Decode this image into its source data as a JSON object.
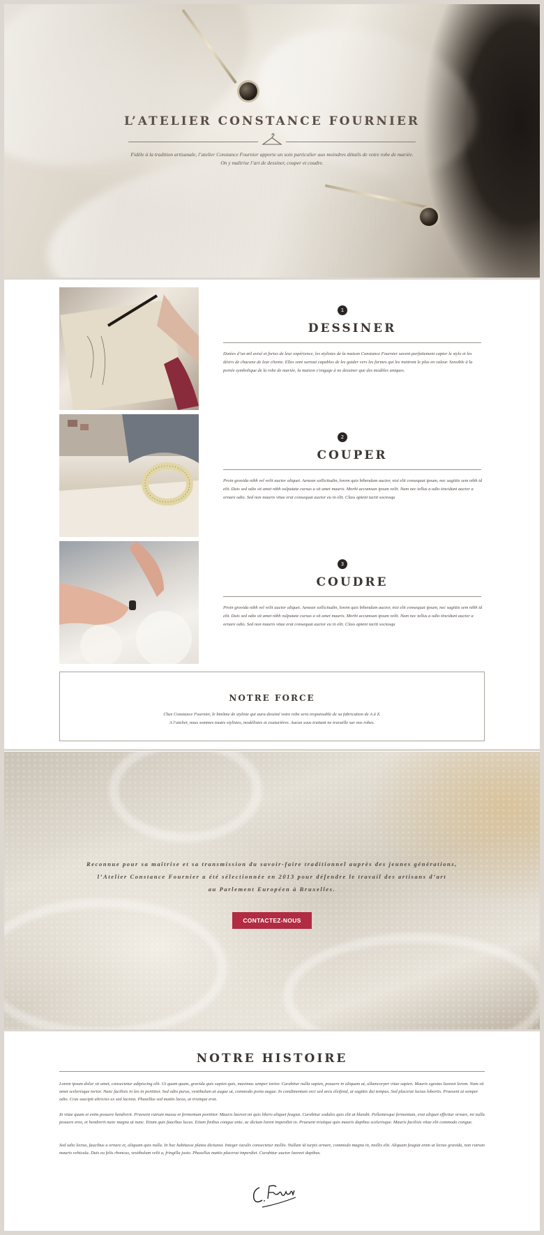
{
  "hero": {
    "title": "L’ATELIER CONSTANCE FOURNIER",
    "tagline_line1": "Fidèle à la tradition artisanale, l’atelier Constance Fournier apporte un soin particulier aux moindres détails de votre robe de mariée.",
    "tagline_line2": "On y maîtrise l’art de dessiner, couper et coudre.",
    "icon": "hanger-icon"
  },
  "steps": [
    {
      "number": "1",
      "title": "DESSINER",
      "text": "Dotées d’un œil avisé et fortes de leur expérience, les stylistes de la maison Constance Fournier savent parfaitement capter le style et les désirs de chacune de leur cliente. Elles sont surtout capables de les guider vers les formes qui les mettront le plus en valeur. Sensible à la portée symbolique de la robe de mariée, la maison s’engage à ne dessiner que des modèles uniques."
    },
    {
      "number": "2",
      "title": "COUPER",
      "text": "Proin gravida nibh vel velit auctor aliquet. Aenean sollicitudin, lorem quis bibendum auctor, nisi elit consequat ipsum, nec sagittis sem nibh id elit. Duis sed odio sit amet nibh vulputate cursus a sit amet mauris. Morbi accumsan ipsum velit. Nam nec tellus a odio tincidunt auctor a ornare odio. Sed non mauris vitae erat consequat auctor eu in elit. Class aptent taciti sociosqu"
    },
    {
      "number": "3",
      "title": "COUDRE",
      "text": "Proin gravida nibh vel velit auctor aliquet. Aenean sollicitudin, lorem quis bibendum auctor, nisi elit consequat ipsum, nec sagittis sem nibh id elit. Duis sed odio sit amet nibh vulputate cursus a sit amet mauris. Morbi accumsan ipsum velit. Nam nec tellus a odio tincidunt auctor a ornare odio. Sed non mauris vitae erat consequat auctor eu in elit. Class aptent taciti sociosqu"
    }
  ],
  "force": {
    "title": "NOTRE FORCE",
    "line1": "Chez Constance Fournier, le binôme de styliste qui aura dessiné votre robe sera responsable de sa fabrication de A à Z.",
    "line2": "A l’atelier, nous sommes toutes stylistes, modélistes et couturières. Aucun sous traitant ne travaille sur nos robes."
  },
  "banner": {
    "line1": "Reconnue pour sa maîtrise et sa transmission du savoir-faire traditionnel auprès des jeunes générations,",
    "line2": "l’Atelier Constance Fournier a été sélectionnée en 2013 pour défendre le travail des artisans d’art",
    "line3": "au Parlement Européen à Bruxelles.",
    "button_label": "CONTACTEZ-NOUS",
    "button_color": "#b12b43"
  },
  "histoire": {
    "title": "NOTRE HISTOIRE",
    "p1": "Lorem ipsum dolor sit amet, consectetur adipiscing elit. Ut quam quam, gravida quis sapien quis, maximus semper tortor. Curabitur nulla sapien, posuere in aliquam at, ullamcorper vitae sapien. Mauris egestas laoreet lorem. Nam sit amet scelerisque tortor. Nunc facilisis in leo in porttitor. Sed odio purus, vestibulum at augue ut, commodo porta augue. In condimentum orci sed arcu eleifend, at sagittis dui tempus. Sed placerat luctus lobortis. Praesent at semper odio. Cras suscipit ultricies ex sed lacinia. Phasellus sed mattis lacus, ut tristique erat.",
    "p2": "In vitae quam et enim posuere hendrerit. Praesent rutrum massa et fermentum porttitor. Mauris laoreet mi quis libero aliquet feugiat. Curabitur sodales quis elit at blandit. Pellentesque fermentum, erat aliquet efficitur ornare, mi nulla posuere eros, et hendrerit nunc magna ut nunc. Etiam quis faucibus lacus. Etiam finibus congue ante, ac dictum lorem imperdiet in. Praesent tristique quis mauris dapibus scelerisque. Mauris facilisis vitae elit commodo congue.",
    "p3": "Sed odio lectus, faucibus a ornare et, aliquam quis nulla. In hac habitasse platea dictumst. Integer iaculis consectetur mollis. Nullam id turpis ornare, commodo magna in, mollis elit. Aliquam feugiat enim ut lectus gravida, non rutrum mauris vehicula. Duis eu felis rhoncus, vestibulum velit a, fringilla justo. Phasellus mattis placerat imperdiet. Curabitur auctor laoreet dapibus.",
    "signature": "C. Fournier"
  }
}
